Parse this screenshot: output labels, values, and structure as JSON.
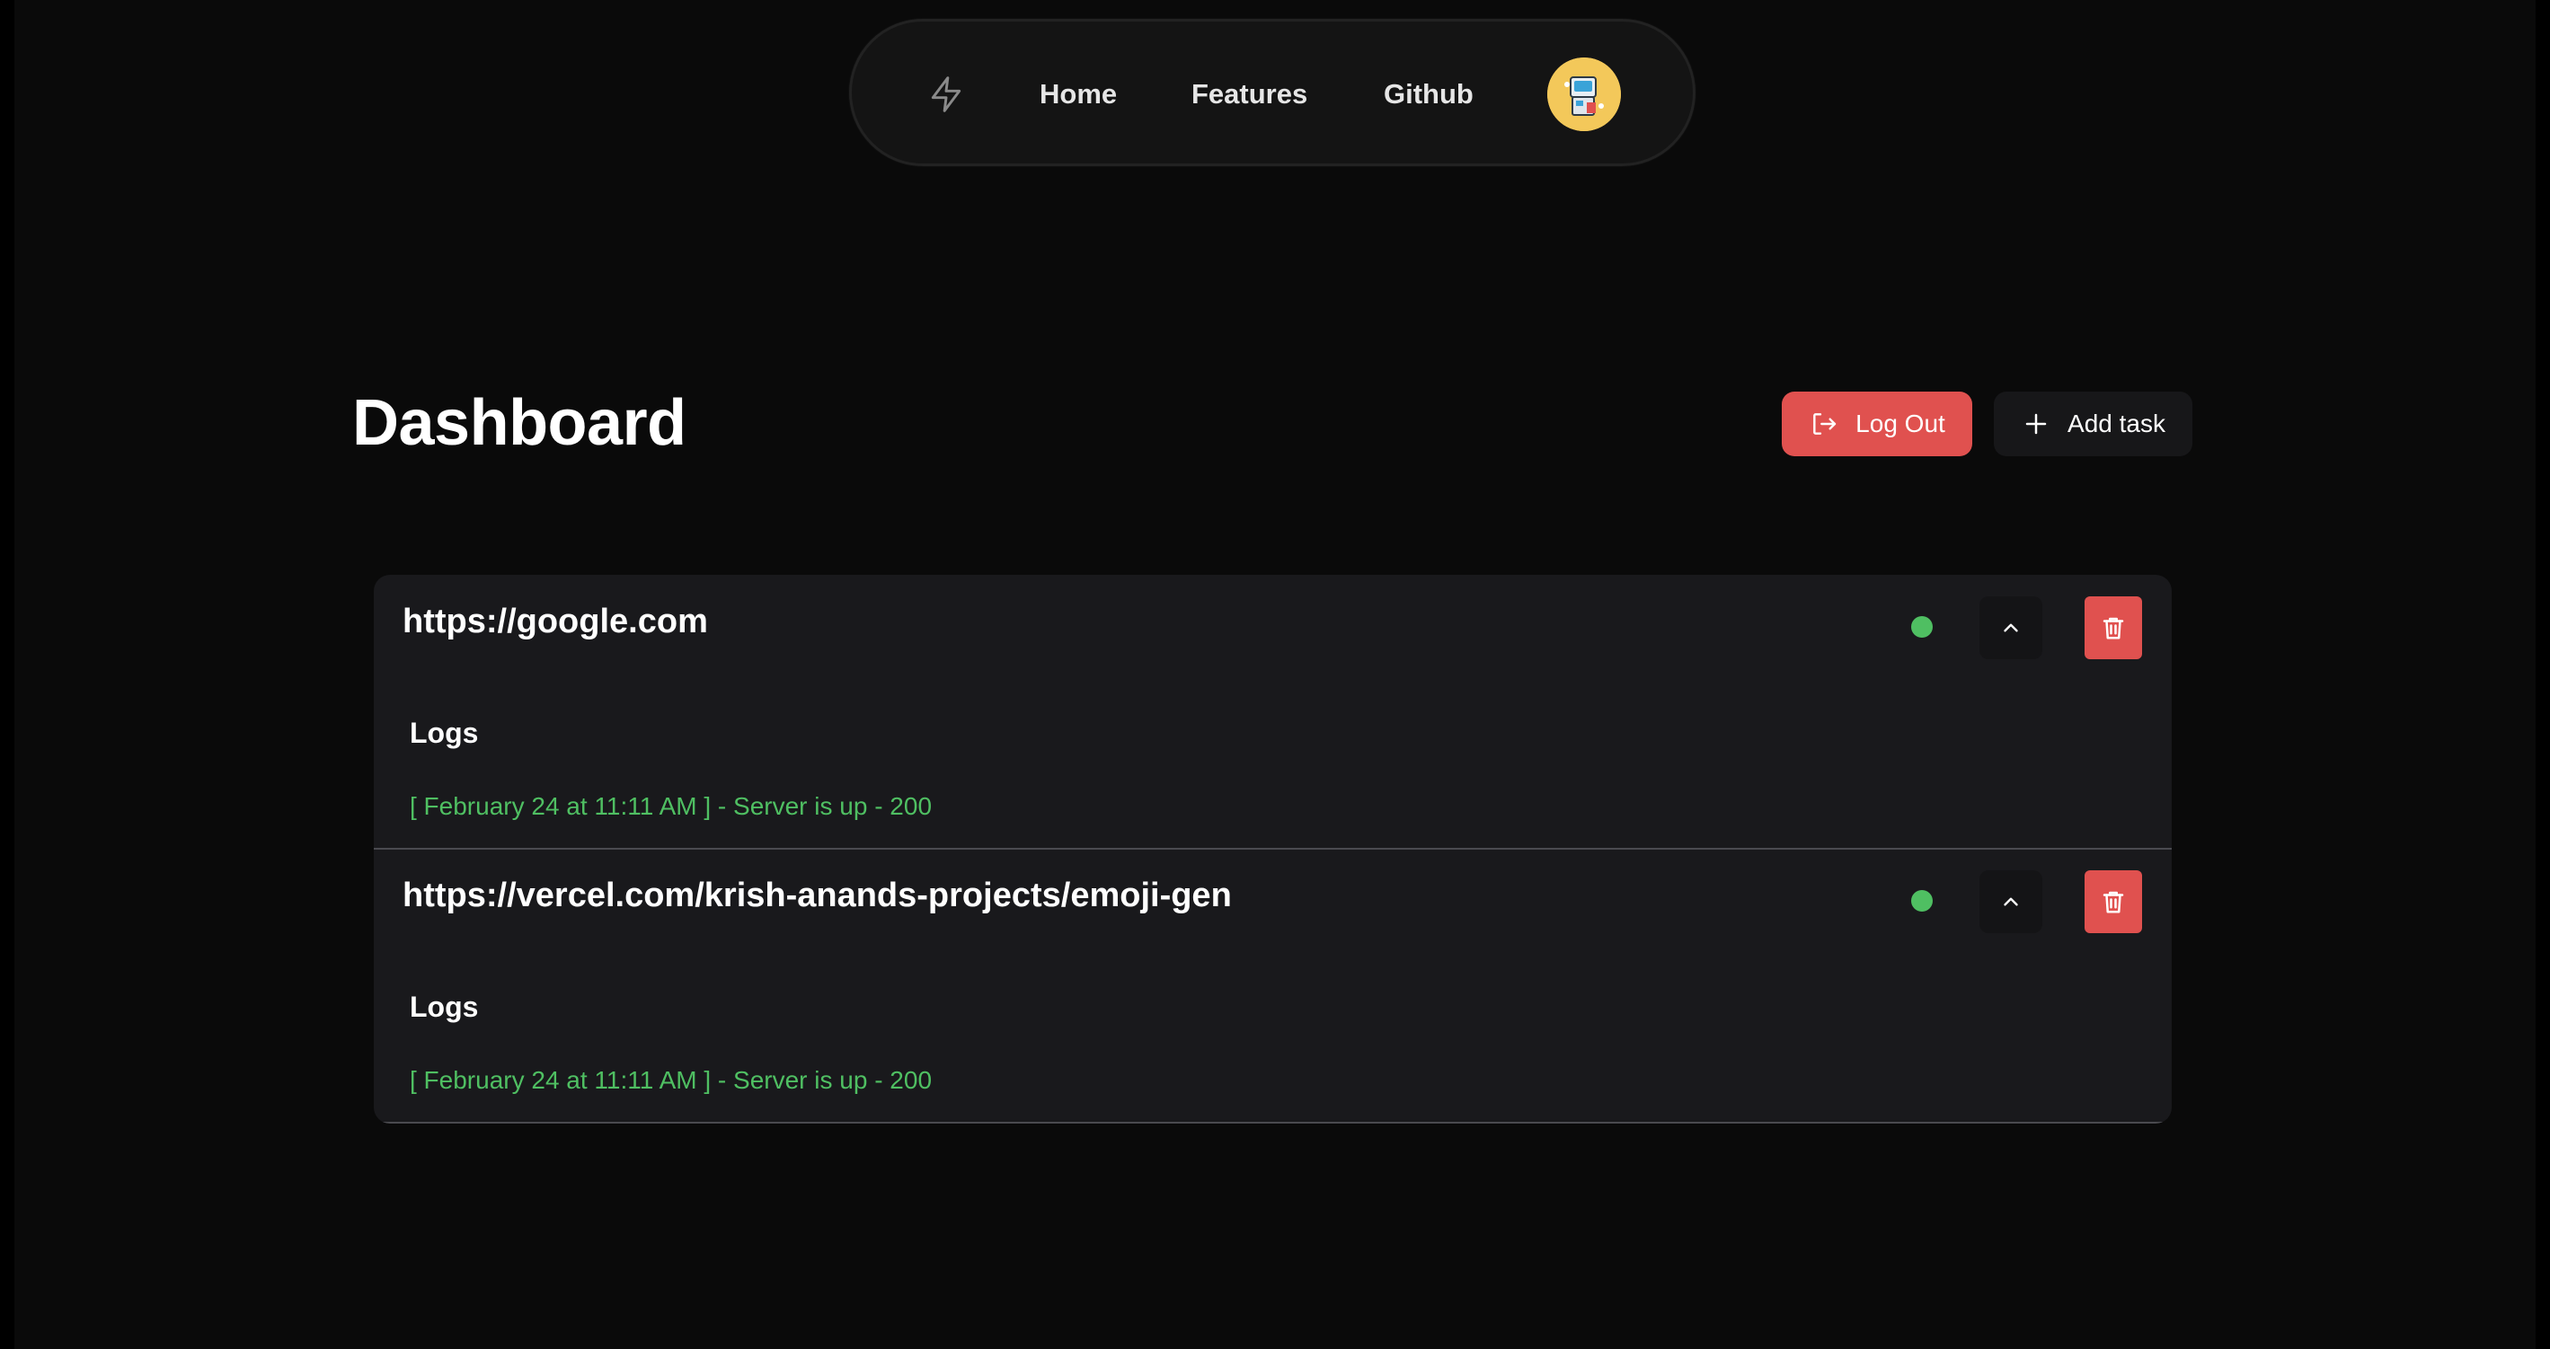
{
  "nav": {
    "logo_icon": "bolt-icon",
    "links": [
      {
        "label": "Home"
      },
      {
        "label": "Features"
      },
      {
        "label": "Github"
      }
    ],
    "avatar_icon": "user-avatar"
  },
  "header": {
    "title": "Dashboard",
    "logout_label": "Log Out",
    "logout_icon": "logout-icon",
    "add_task_label": "Add task",
    "add_task_icon": "plus-icon"
  },
  "colors": {
    "background": "#0a0a0a",
    "card": "#19191c",
    "danger": "#e0514f",
    "success": "#4fbf62",
    "avatar_bg": "#f3c85a"
  },
  "tasks": [
    {
      "url": "https://google.com",
      "status": "up",
      "logs_title": "Logs",
      "logs": [
        "[ February 24 at 11:11 AM ] - Server is up - 200"
      ]
    },
    {
      "url": "https://vercel.com/krish-anands-projects/emoji-gen",
      "status": "up",
      "logs_title": "Logs",
      "logs": [
        "[ February 24 at 11:11 AM ] - Server is up - 200"
      ]
    }
  ]
}
